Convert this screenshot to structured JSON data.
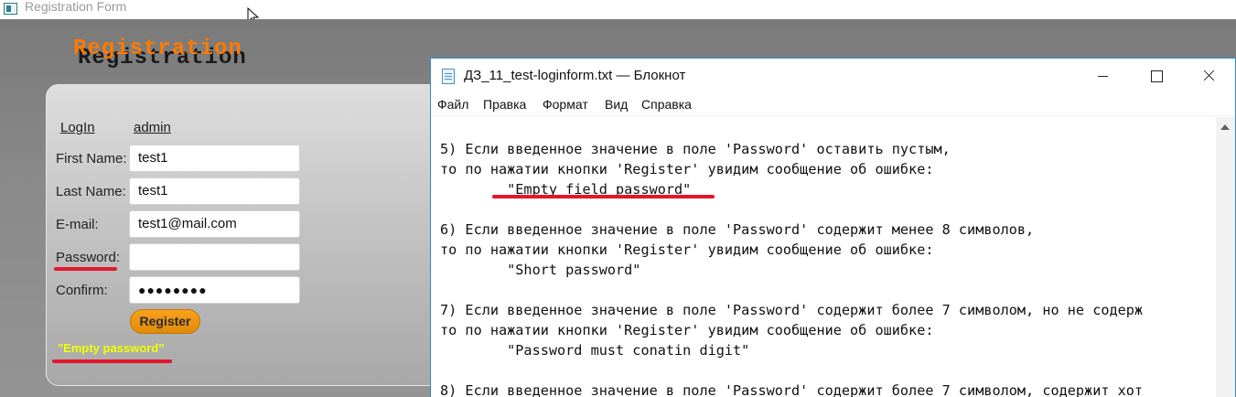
{
  "registration_window": {
    "title": "Registration Form",
    "heading": "Registration",
    "links": {
      "login": "LogIn",
      "admin": "admin"
    },
    "fields": [
      {
        "label": "First Name:",
        "value": "test1"
      },
      {
        "label": "Last Name:",
        "value": "test1"
      },
      {
        "label": "E-mail:",
        "value": "test1@mail.com"
      },
      {
        "label": "Password:",
        "value": ""
      },
      {
        "label": "Confirm:",
        "value": "●●●●●●●●"
      }
    ],
    "register_button": "Register",
    "error_message": "\"Empty password\""
  },
  "notepad_window": {
    "title": "ДЗ_11_test-loginform.txt — Блокнот",
    "menu": [
      "Файл",
      "Правка",
      "Формат",
      "Вид",
      "Справка"
    ],
    "lines": [
      "5) Если введенное значение в поле 'Password' оставить пустым,",
      "то по нажатии кнопки 'Register' увидим сообщение об ошибке:",
      "        \"Empty field password\"",
      "",
      "6) Если введенное значение в поле 'Password' содержит менее 8 символов,",
      "то по нажатии кнопки 'Register' увидим сообщение об ошибке:",
      "        \"Short password\"",
      "",
      "7) Если введенное значение в поле 'Password' содержит более 7 символом, но не содерж",
      "то по нажатии кнопки 'Register' увидим сообщение об ошибке:",
      "        \"Password must conatin digit\"",
      "",
      "8) Если введенное значение в поле 'Password' содержит более 7 символом, содержит хот"
    ]
  },
  "colors": {
    "accent_orange": "#ff7a00",
    "error_yellow": "#f2ff00",
    "annotation_red": "#e3162a",
    "window_border_blue": "#2b8ad8"
  }
}
